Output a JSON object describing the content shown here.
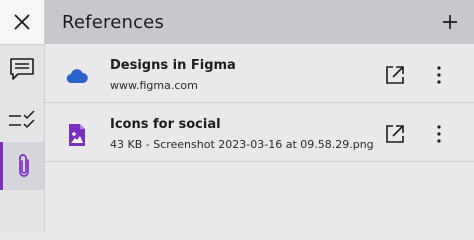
{
  "panel": {
    "title": "References"
  },
  "references": [
    {
      "name": "Designs in Figma",
      "detail": "www.figma.com",
      "icon": "cloud-icon"
    },
    {
      "name": "Icons for social",
      "detail": "43 KB - Screenshot 2023-03-16 at 09.58.29.png",
      "icon": "image-file-icon"
    }
  ],
  "colors": {
    "cloud": "#2a62c9",
    "file": "#7b2fbf",
    "accent": "#7b2fbf"
  }
}
